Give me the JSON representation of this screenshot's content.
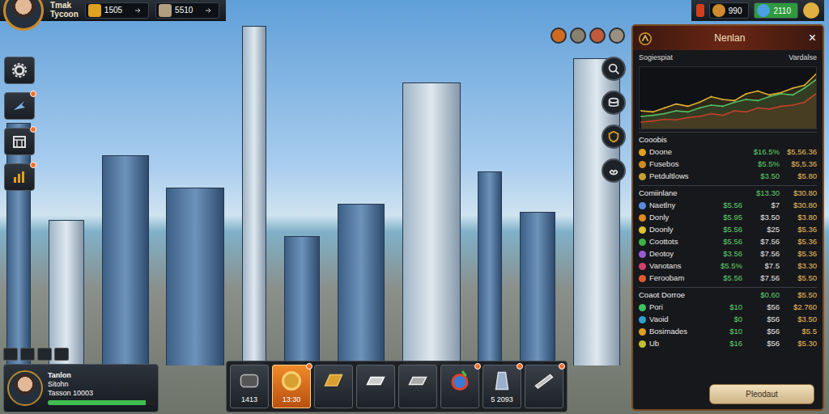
{
  "hud": {
    "title_lines": [
      "Tmak",
      "Tycoon"
    ],
    "resources": [
      {
        "value": "1505"
      },
      {
        "value": "5510"
      }
    ],
    "right_resources": [
      {
        "value": "990"
      },
      {
        "value": "2110"
      }
    ]
  },
  "sidebar": {
    "items": [
      {
        "badge": false
      },
      {
        "badge": true
      },
      {
        "badge": true
      },
      {
        "badge": true
      }
    ]
  },
  "panel": {
    "title": "Nenlan",
    "close": "×",
    "chart": {
      "title": "Sogiespiat",
      "subtitle": "Vardalse",
      "series": [
        {
          "values": [
            20,
            22,
            25,
            30,
            28,
            35,
            40,
            38,
            45,
            50,
            48,
            55,
            60,
            58,
            70,
            85
          ],
          "color": "#3fbf6f"
        },
        {
          "values": [
            30,
            28,
            35,
            42,
            38,
            45,
            55,
            50,
            48,
            60,
            65,
            58,
            62,
            70,
            75,
            95
          ],
          "color": "#e0b030"
        },
        {
          "values": [
            10,
            12,
            15,
            14,
            18,
            20,
            25,
            22,
            30,
            28,
            35,
            33,
            38,
            40,
            45,
            60
          ],
          "color": "#c0402a"
        }
      ]
    },
    "sections": [
      {
        "title": "Cooobis",
        "header_values": [],
        "rows": [
          {
            "name": "Doone",
            "values": [
              "$16.5%",
              "$5,56.36"
            ],
            "color": "#e0a020"
          },
          {
            "name": "Fusebos",
            "values": [
              "$5.5%",
              "$5,5.36"
            ],
            "color": "#d08a20"
          },
          {
            "name": "Petdultlows",
            "values": [
              "$3.50",
              "$5.80"
            ],
            "color": "#c8a030"
          }
        ]
      },
      {
        "title": "Comiinlane",
        "header_values": [
          "$13.30",
          "$30.80"
        ],
        "rows": [
          {
            "name": "Naetlny",
            "values": [
              "$5.56",
              "$7",
              "$30.80"
            ],
            "color": "#5a8ae0"
          },
          {
            "name": "Donly",
            "values": [
              "$5.95",
              "$3.50",
              "$3.80"
            ],
            "color": "#e08a20"
          },
          {
            "name": "Doonly",
            "values": [
              "$5.56",
              "$25",
              "$5.36"
            ],
            "color": "#e0c030"
          },
          {
            "name": "Coottots",
            "values": [
              "$5.56",
              "$7.56",
              "$5.36"
            ],
            "color": "#40b040"
          },
          {
            "name": "Deotoy",
            "values": [
              "$3.56",
              "$7.56",
              "$5.36"
            ],
            "color": "#9a5ad0"
          },
          {
            "name": "Vanotans",
            "values": [
              "$5.5%",
              "$7.5",
              "$3.30"
            ],
            "color": "#d04070"
          },
          {
            "name": "Feroobam",
            "values": [
              "$5.56",
              "$7.56",
              "$5.50"
            ],
            "color": "#e05a30"
          }
        ]
      },
      {
        "title": "Coaot Dorroe",
        "header_values": [
          "$0.60",
          "$5.50"
        ],
        "rows": [
          {
            "name": "Pori",
            "values": [
              "$10",
              "$56",
              "$2.760"
            ],
            "color": "#40c060"
          },
          {
            "name": "Vaoid",
            "values": [
              "$0",
              "$56",
              "$3.50"
            ],
            "color": "#30a0d0"
          },
          {
            "name": "Bosimades",
            "values": [
              "$10",
              "$56",
              "$5.5"
            ],
            "color": "#e0a020"
          },
          {
            "name": "Ub",
            "values": [
              "$16",
              "$56",
              "$5.30"
            ],
            "color": "#c0c030"
          }
        ]
      }
    ],
    "button": "Pleodaut"
  },
  "player": {
    "name": "Tanlon",
    "subtitle": "Sitohn",
    "xp": "Tasson 10003",
    "level": 0.92
  },
  "items": [
    {
      "count": "1413",
      "selected": false,
      "badge": false
    },
    {
      "count": "13:30",
      "selected": true,
      "badge": true
    },
    {
      "selected": false,
      "badge": false
    },
    {
      "selected": false,
      "badge": false
    },
    {
      "selected": false,
      "badge": false
    },
    {
      "selected": false,
      "badge": true
    },
    {
      "count": "5 2093",
      "selected": false,
      "badge": true
    },
    {
      "selected": false,
      "badge": true
    }
  ]
}
